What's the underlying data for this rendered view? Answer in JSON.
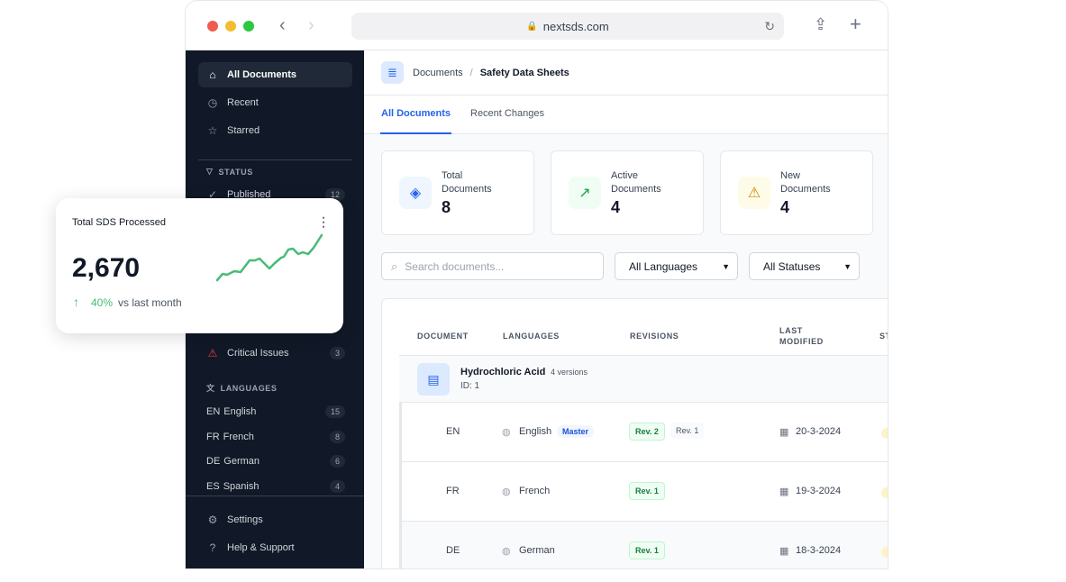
{
  "browser": {
    "url": "nextsds.com"
  },
  "sidebar": {
    "nav": [
      {
        "label": "All Documents",
        "icon": "home-icon"
      },
      {
        "label": "Recent",
        "icon": "clock-icon"
      },
      {
        "label": "Starred",
        "icon": "star-icon"
      }
    ],
    "status_heading": "STATUS",
    "status": [
      {
        "label": "Published",
        "count": "12"
      },
      {
        "label": "Critical Issues",
        "count": "3"
      }
    ],
    "languages_heading": "LANGUAGES",
    "languages": [
      {
        "code": "EN",
        "label": "English",
        "count": "15"
      },
      {
        "code": "FR",
        "label": "French",
        "count": "8"
      },
      {
        "code": "DE",
        "label": "German",
        "count": "6"
      },
      {
        "code": "ES",
        "label": "Spanish",
        "count": "4"
      }
    ],
    "footer": [
      {
        "label": "Settings"
      },
      {
        "label": "Help & Support"
      }
    ]
  },
  "breadcrumb": {
    "parent": "Documents",
    "sep": "/",
    "current": "Safety Data Sheets"
  },
  "tabs": [
    {
      "label": "All Documents",
      "active": true
    },
    {
      "label": "Recent Changes"
    }
  ],
  "stats": [
    {
      "label1": "Total",
      "label2": "Documents",
      "value": "8",
      "color": "#2563eb"
    },
    {
      "label1": "Active",
      "label2": "Documents",
      "value": "4",
      "color": "#16a34a"
    },
    {
      "label1": "New",
      "label2": "Documents",
      "value": "4",
      "color": "#ca8a04"
    }
  ],
  "filters": {
    "search_placeholder": "Search documents...",
    "language": "All Languages",
    "status": "All Statuses"
  },
  "table": {
    "headers": [
      "DOCUMENT",
      "LANGUAGES",
      "REVISIONS",
      "LAST",
      "MODIFIED",
      "ST"
    ],
    "group": {
      "name": "Hydrochloric Acid",
      "versions": "4 versions",
      "id": "ID: 1"
    },
    "rows": [
      {
        "code": "EN",
        "language": "English",
        "master": "Master",
        "revs": [
          "Rev. 2",
          "Rev. 1"
        ],
        "date": "20-3-2024"
      },
      {
        "code": "FR",
        "language": "French",
        "revs": [
          "Rev. 1"
        ],
        "date": "19-3-2024"
      },
      {
        "code": "DE",
        "language": "German",
        "revs": [
          "Rev. 1"
        ],
        "date": "18-3-2024"
      }
    ]
  },
  "widget": {
    "title": "Total SDS Processed",
    "value": "2,670",
    "change": "40%",
    "change_label": "vs last month",
    "trend_color": "#48bb78"
  }
}
